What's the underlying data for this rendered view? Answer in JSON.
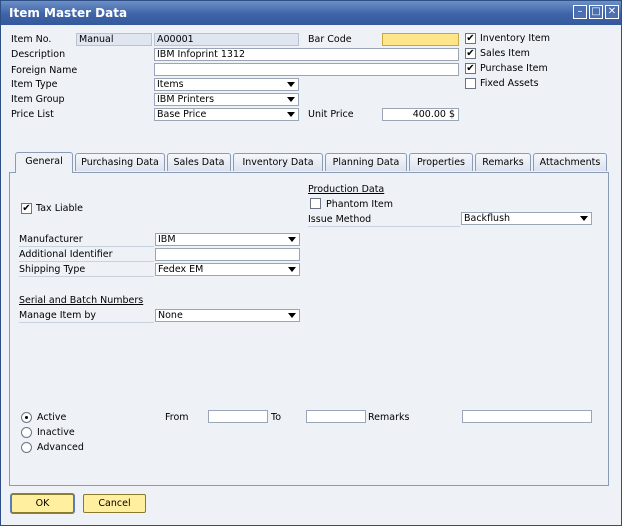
{
  "window": {
    "title": "Item Master Data"
  },
  "header": {
    "item_no": {
      "label": "Item No.",
      "series": "Manual",
      "value": "A00001"
    },
    "description": {
      "label": "Description",
      "value": "IBM Infoprint 1312"
    },
    "foreign_name": {
      "label": "Foreign Name",
      "value": ""
    },
    "item_type": {
      "label": "Item Type",
      "value": "Items"
    },
    "item_group": {
      "label": "Item Group",
      "value": "IBM Printers"
    },
    "price_list": {
      "label": "Price List",
      "value": "Base Price"
    },
    "bar_code": {
      "label": "Bar Code",
      "value": ""
    },
    "unit_price": {
      "label": "Unit Price",
      "value": "400.00 $"
    },
    "flags": [
      {
        "label": "Inventory Item",
        "checked": true
      },
      {
        "label": "Sales Item",
        "checked": true
      },
      {
        "label": "Purchase Item",
        "checked": true
      },
      {
        "label": "Fixed Assets",
        "checked": false
      }
    ]
  },
  "tabs": [
    {
      "label": "General",
      "active": true
    },
    {
      "label": "Purchasing Data"
    },
    {
      "label": "Sales Data"
    },
    {
      "label": "Inventory Data"
    },
    {
      "label": "Planning Data"
    },
    {
      "label": "Properties"
    },
    {
      "label": "Remarks"
    },
    {
      "label": "Attachments"
    }
  ],
  "general": {
    "tax_liable": {
      "label": "Tax Liable",
      "checked": true
    },
    "production": {
      "heading": "Production Data",
      "phantom_label": "Phantom Item",
      "phantom_checked": false,
      "issue_method_label": "Issue Method",
      "issue_method": "Backflush"
    },
    "manufacturer": {
      "label": "Manufacturer",
      "value": "IBM"
    },
    "additional_identifier": {
      "label": "Additional Identifier",
      "value": ""
    },
    "shipping_type": {
      "label": "Shipping Type",
      "value": "Fedex EM"
    },
    "serial_heading": "Serial and Batch Numbers",
    "manage_item_by": {
      "label": "Manage Item by",
      "value": "None"
    },
    "status": {
      "options": [
        {
          "label": "Active",
          "selected": true
        },
        {
          "label": "Inactive",
          "selected": false
        },
        {
          "label": "Advanced",
          "selected": false
        }
      ],
      "from_label": "From",
      "to_label": "To",
      "remarks_label": "Remarks",
      "from": "",
      "to": "",
      "remarks": ""
    }
  },
  "footer": {
    "ok": "OK",
    "cancel": "Cancel"
  }
}
